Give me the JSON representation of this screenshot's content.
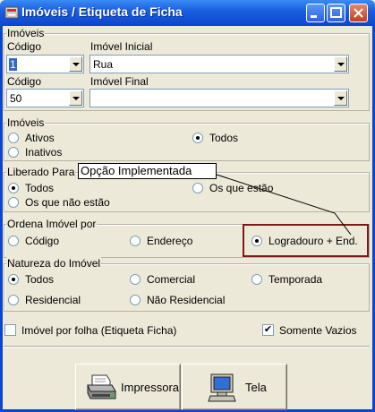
{
  "window": {
    "title": "Imóveis / Etiqueta de Ficha"
  },
  "imoveis_top": {
    "group_label": "Imóveis",
    "codigo_label_1": "Código",
    "codigo_value_1": "1",
    "imovel_inicial_label": "Imóvel Inicial",
    "imovel_inicial_value": "Rua",
    "codigo_label_2": "Código",
    "codigo_value_2": "50",
    "imovel_final_label": "Imóvel Final",
    "imovel_final_value": ""
  },
  "imoveis_filter": {
    "group_label": "Imóveis",
    "options": [
      "Ativos",
      "Inativos",
      "Todos"
    ],
    "selected": "Todos"
  },
  "liberado": {
    "group_label": "Liberado Para",
    "options": [
      "Todos",
      "Os que não estão",
      "Os que estão"
    ],
    "selected": "Todos"
  },
  "tooltip": {
    "text": "Opção Implementada"
  },
  "ordena": {
    "group_label": "Ordena Imóvel por",
    "options": [
      "Código",
      "Endereço",
      "Logradouro + End."
    ],
    "selected": "Logradouro + End."
  },
  "natureza": {
    "group_label": "Natureza do Imóvel",
    "options": [
      "Todos",
      "Comercial",
      "Temporada",
      "Residencial",
      "Não Residencial"
    ],
    "selected": "Todos"
  },
  "checks": {
    "imovel_por_folha": {
      "label": "Imóvel por folha (Etiqueta Ficha)",
      "checked": false
    },
    "somente_vazios": {
      "label": "Somente Vazios",
      "checked": true
    }
  },
  "buttons": {
    "impressora": "Impressora",
    "tela": "Tela"
  },
  "icons": {
    "app": "app-icon",
    "printer": "printer-icon",
    "monitor": "monitor-icon"
  },
  "colors": {
    "titlebar": "#0a46cf",
    "highlight": "#7b1a1a",
    "face": "#ece9d8"
  }
}
